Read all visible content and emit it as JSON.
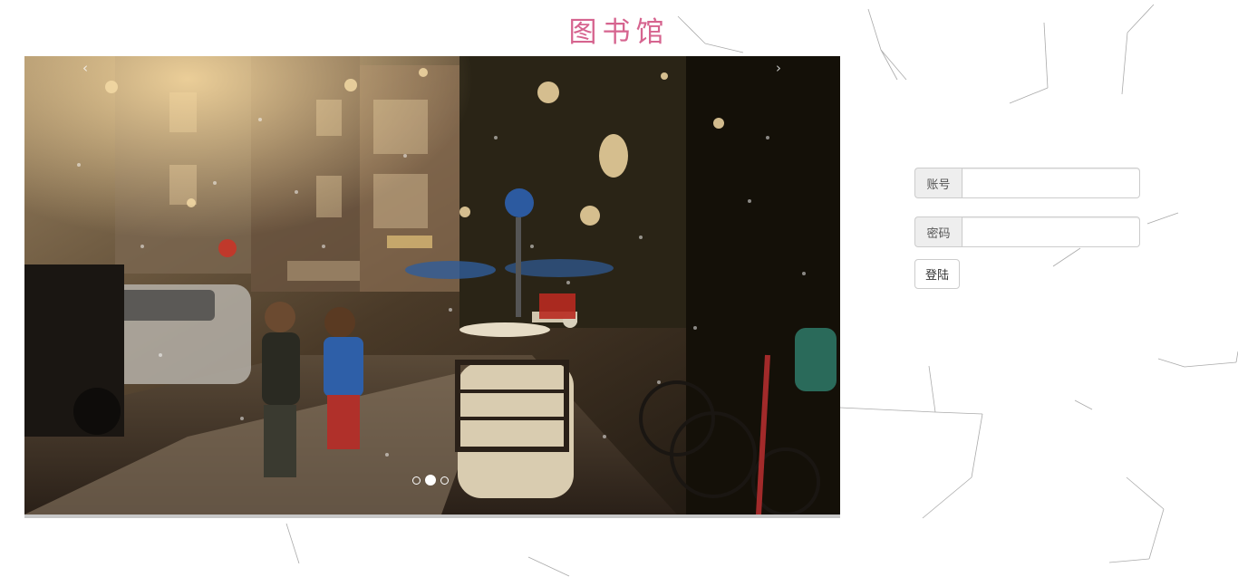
{
  "page": {
    "title": "图书馆"
  },
  "carousel": {
    "prev_label": "‹",
    "next_label": "›",
    "slide_count": 3,
    "active_slide": 2,
    "slide_image": "rainy-street-scooter-children-photo"
  },
  "login": {
    "account_label": "账号",
    "account_value": "",
    "password_label": "密码",
    "password_value": "",
    "submit_label": "登陆"
  },
  "colors": {
    "title": "#d6648f",
    "background": "#ffffff",
    "network_lines": "#999999"
  }
}
